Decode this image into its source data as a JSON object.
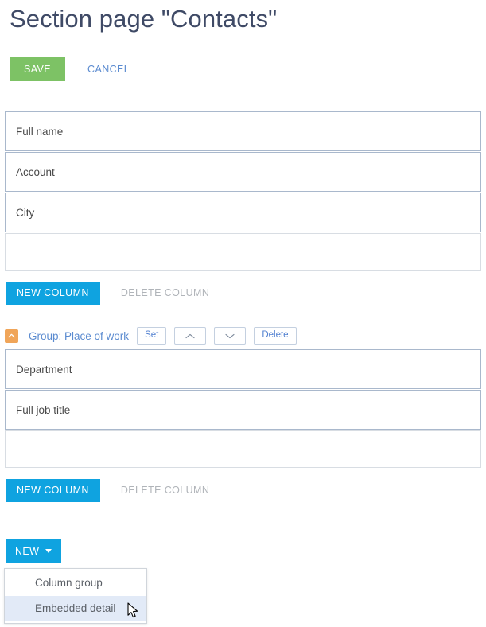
{
  "page": {
    "title": "Section page \"Contacts\""
  },
  "action_bar": {
    "save_label": "SAVE",
    "cancel_label": "CANCEL"
  },
  "main_section": {
    "fields": [
      {
        "label": "Full name"
      },
      {
        "label": "Account"
      },
      {
        "label": "City"
      }
    ],
    "drop_zone": "",
    "new_column_label": "NEW COLUMN",
    "delete_column_label": "DELETE COLUMN"
  },
  "group_section": {
    "collapse_icon": "chevron-up-icon",
    "title": "Group: Place of work",
    "buttons": {
      "set_label": "Set",
      "move_up_icon": "chevron-up-icon",
      "move_down_icon": "chevron-down-icon",
      "delete_label": "Delete"
    },
    "fields": [
      {
        "label": "Department"
      },
      {
        "label": "Full job title"
      }
    ],
    "drop_zone": "",
    "new_column_label": "NEW COLUMN",
    "delete_column_label": "DELETE COLUMN"
  },
  "new_dropdown": {
    "button_label": "NEW",
    "caret_icon": "caret-down-icon",
    "items": [
      {
        "label": "Column group",
        "active": false
      },
      {
        "label": "Embedded detail",
        "active": true
      }
    ]
  },
  "colors": {
    "save_green": "#7dc265",
    "primary_blue": "#0fa3e0",
    "link_blue": "#5b8bd0",
    "collapse_orange": "#f0a559",
    "title_slate": "#3f4a66",
    "field_border": "#a9b8cc",
    "menu_highlight": "#e2eaf7"
  }
}
